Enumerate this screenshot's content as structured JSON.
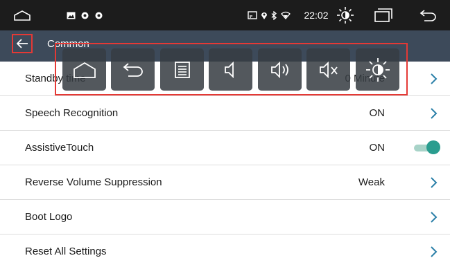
{
  "status_bar": {
    "time": "22:02",
    "icons": [
      "home-outline-icon",
      "gallery-icon",
      "settings-gear-icon",
      "settings-gear-icon",
      "screen-cast-icon",
      "location-pin-icon",
      "bluetooth-icon",
      "wifi-icon",
      "brightness-icon",
      "window-icon",
      "back-arrow-icon"
    ]
  },
  "title_bar": {
    "title": "Common",
    "back_icon": "arrow-left-icon"
  },
  "settings": [
    {
      "label": "Standby time",
      "value": "0 Minute",
      "control": "chevron"
    },
    {
      "label": "Speech Recognition",
      "value": "ON",
      "control": "chevron"
    },
    {
      "label": "AssistiveTouch",
      "value": "ON",
      "control": "toggle",
      "toggle_on": true
    },
    {
      "label": "Reverse Volume Suppression",
      "value": "Weak",
      "control": "chevron"
    },
    {
      "label": "Boot Logo",
      "value": "",
      "control": "chevron"
    },
    {
      "label": "Reset All Settings",
      "value": "",
      "control": "chevron"
    }
  ],
  "quick_panel": {
    "buttons": [
      "home-icon",
      "back-icon",
      "menu-list-icon",
      "volume-down-icon",
      "volume-up-icon",
      "mute-icon",
      "brightness-icon"
    ]
  },
  "colors": {
    "status_bar_bg": "#1c1c1c",
    "title_bar_bg": "#3d4a5a",
    "highlight": "#e53935",
    "toggle_on": "#2a9d8f",
    "chevron": "#2a7fa8"
  }
}
